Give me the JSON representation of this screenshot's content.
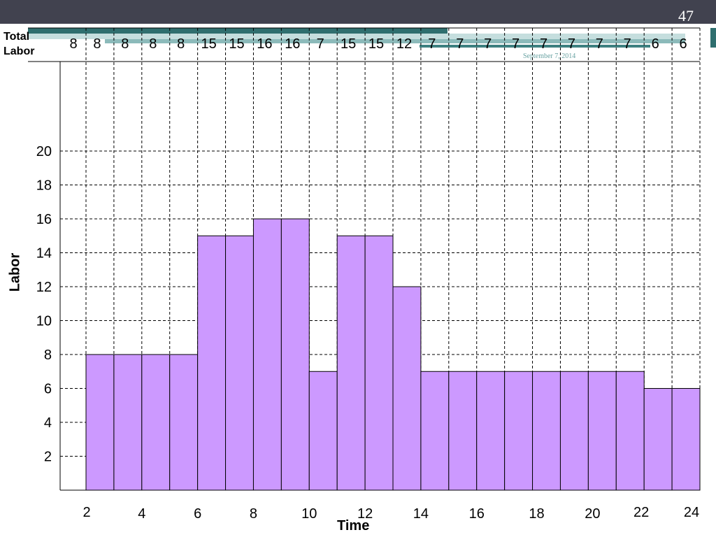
{
  "slide": {
    "number": "47",
    "date_footer": "September 7, 2014"
  },
  "header_row": {
    "label": "Total Labor"
  },
  "colors": {
    "bar_fill": "#cc99ff",
    "bar_stroke": "#000000",
    "top_band": "#41424f"
  },
  "chart_data": {
    "type": "bar",
    "title": "",
    "xlabel": "Time",
    "ylabel": "Labor",
    "ylim": [
      0,
      20
    ],
    "yticks": [
      2,
      4,
      6,
      8,
      10,
      12,
      14,
      16,
      18,
      20
    ],
    "xticks": [
      2,
      4,
      6,
      8,
      10,
      12,
      14,
      16,
      18,
      20,
      22,
      24
    ],
    "grid": true,
    "x": [
      2,
      3,
      4,
      5,
      6,
      7,
      8,
      9,
      10,
      11,
      12,
      13,
      14,
      15,
      16,
      17,
      18,
      19,
      20,
      21,
      22,
      23
    ],
    "values": [
      8,
      8,
      8,
      8,
      15,
      15,
      16,
      16,
      7,
      15,
      15,
      12,
      7,
      7,
      7,
      7,
      7,
      7,
      7,
      7,
      6,
      6
    ],
    "total_labor_row": [
      "8",
      "8",
      "8",
      "8",
      "8",
      "15",
      "15",
      "16",
      "16",
      "7",
      "15",
      "15",
      "12",
      "7",
      "7",
      "7",
      "7",
      "7",
      "7",
      "7",
      "7",
      "6",
      "6"
    ]
  }
}
